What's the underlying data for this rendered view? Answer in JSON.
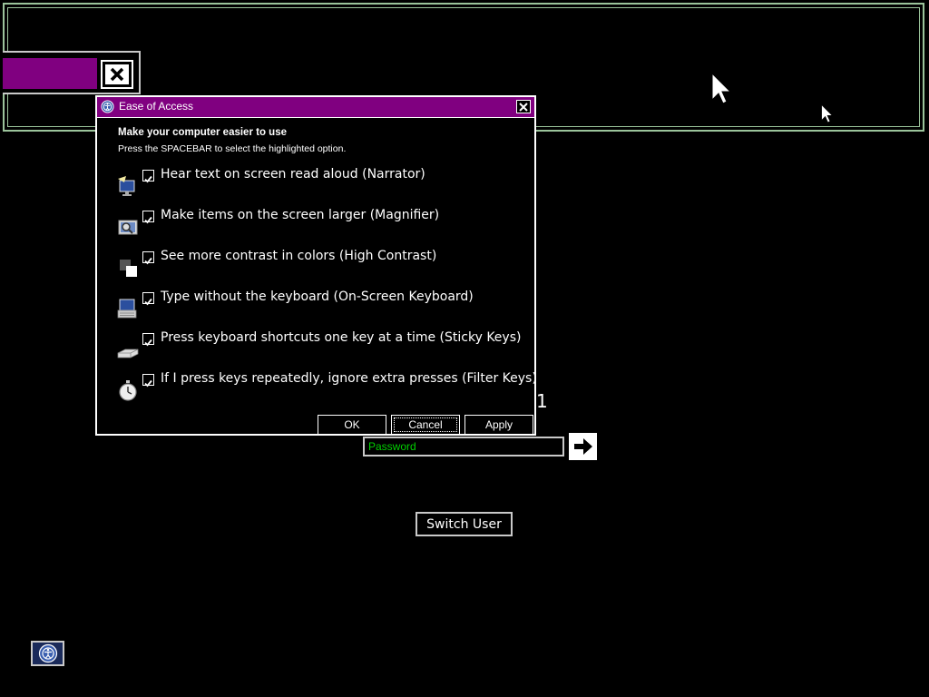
{
  "dialog": {
    "title": "Ease of Access",
    "heading": "Make your computer easier to use",
    "subheading": "Press the SPACEBAR to select the highlighted option.",
    "options": [
      {
        "label": "Hear text on screen read aloud (Narrator)",
        "icon": "narrator-icon",
        "checked": true
      },
      {
        "label": "Make items on the screen larger (Magnifier)",
        "icon": "magnifier-icon",
        "checked": true
      },
      {
        "label": "See more contrast in colors (High Contrast)",
        "icon": "high-contrast-icon",
        "checked": true
      },
      {
        "label": "Type without the keyboard (On-Screen Keyboard)",
        "icon": "on-screen-keyboard-icon",
        "checked": true
      },
      {
        "label": "Press keyboard shortcuts one key at a time (Sticky Keys)",
        "icon": "sticky-keys-icon",
        "checked": true
      },
      {
        "label": "If I press keys repeatedly, ignore extra presses (Filter Keys)",
        "icon": "filter-keys-icon",
        "checked": true
      }
    ],
    "buttons": {
      "ok": "OK",
      "cancel": "Cancel",
      "apply": "Apply"
    }
  },
  "login": {
    "user_number": "1",
    "password_placeholder": "Password",
    "switch_user": "Switch User"
  },
  "colors": {
    "titlebar": "#800080",
    "background": "#000000",
    "border": "#ffffff",
    "password_text": "#00d000"
  }
}
